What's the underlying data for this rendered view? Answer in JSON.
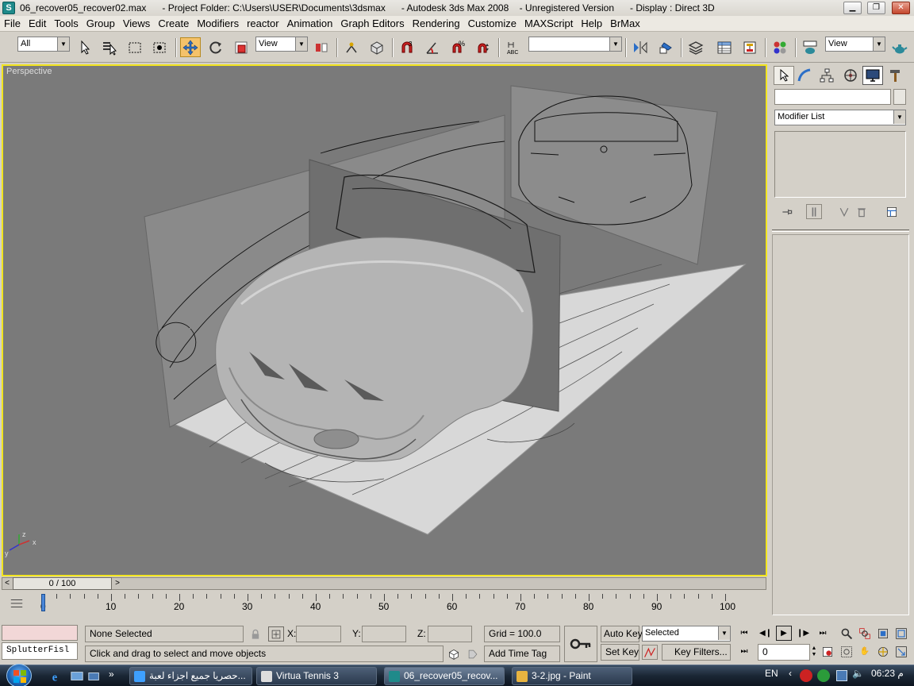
{
  "window": {
    "title": "06_recover05_recover02.max      - Project Folder: C:\\Users\\USER\\Documents\\3dsmax      - Autodesk 3ds Max 2008    - Unregistered Version      - Display : Direct 3D",
    "app_icon": "3ds-max-icon"
  },
  "menu": [
    "File",
    "Edit",
    "Tools",
    "Group",
    "Views",
    "Create",
    "Modifiers",
    "reactor",
    "Animation",
    "Graph Editors",
    "Rendering",
    "Customize",
    "MAXScript",
    "Help",
    "BrMax"
  ],
  "toolbar": {
    "selection_filter": "All",
    "ref_coord": "View",
    "named_selection": "",
    "view_right": "View",
    "snap_label": "3",
    "angle_label": "%"
  },
  "viewport": {
    "label": "Perspective",
    "axis_x": "x",
    "axis_y": "y",
    "axis_z": "z"
  },
  "command_panel": {
    "name_field": "",
    "modifier_list": "Modifier List"
  },
  "timeline": {
    "slider": "0 / 100",
    "ticks": [
      "0",
      "10",
      "20",
      "30",
      "40",
      "50",
      "60",
      "70",
      "80",
      "90",
      "100"
    ]
  },
  "status": {
    "maxscript": "SplutterFisl",
    "selection": "None Selected",
    "prompt": "Click and drag to select and move objects",
    "x_label": "X:",
    "y_label": "Y:",
    "z_label": "Z:",
    "x": "",
    "y": "",
    "z": "",
    "grid": "Grid = 100.0",
    "add_time_tag": "Add Time Tag",
    "auto_key": "Auto Key",
    "selected": "Selected",
    "set_key": "Set Key",
    "key_filters": "Key Filters...",
    "frame": "0"
  },
  "taskbar": {
    "tasks": [
      "حصريا جميع اجزاء لعبة...",
      "Virtua Tennis 3",
      "06_recover05_recov...",
      "3-2.jpg - Paint"
    ],
    "lang": "EN",
    "clock": "06:23 م",
    "start": "start-button"
  }
}
